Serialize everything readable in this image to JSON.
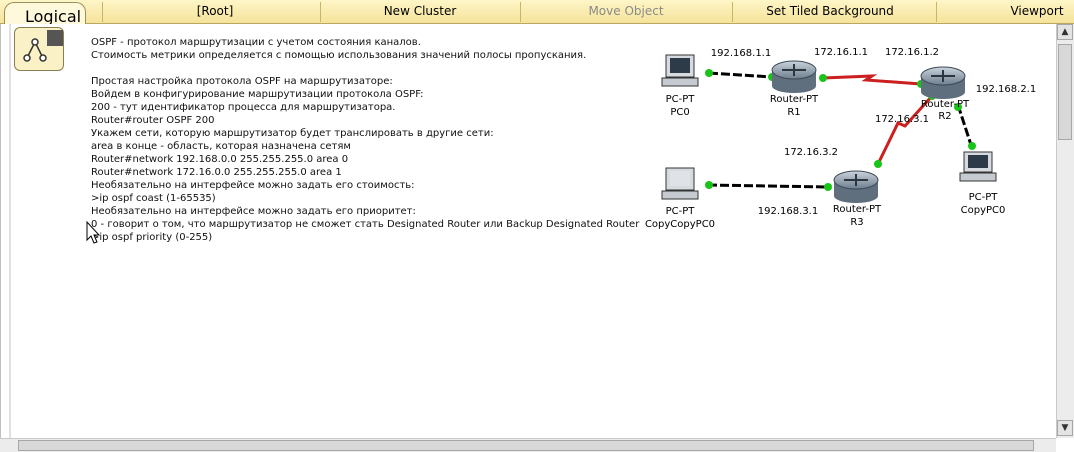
{
  "topbar": {
    "logical_tab": "Logical",
    "buttons": [
      {
        "label": "[Root]",
        "disabled": false
      },
      {
        "label": "New Cluster",
        "disabled": false
      },
      {
        "label": "Move Object",
        "disabled": true
      },
      {
        "label": "Set Tiled Background",
        "disabled": false
      },
      {
        "label": "Viewport",
        "disabled": false
      }
    ]
  },
  "notes": [
    "OSPF - протокол маршрутизации с учетом состояния каналов.",
    "Стоимость метрики определяется с помощью использования значений полосы пропускания.",
    "",
    "Простая настройка протокола OSPF на маршрутизаторе:",
    "Войдем в конфигурирование маршрутизации протокола OSPF:",
    "200 - тут идентификатор процесса для маршрутизатора.",
    "Router#router OSPF 200",
    "Укажем сети, которую маршрутизатор будет транслировать в другие сети:",
    "area в конце - область, которая назначена сетям",
    "Router#network 192.168.0.0 255.255.255.0 area 0",
    "Router#network 172.16.0.0 255.255.255.0 area 1",
    "Необязательно на интерфейсе можно задать его стоимость:",
    ">ip ospf coast (1-65535)",
    "Необязательно на интерфейсе можно задать его приоритет:",
    "0 - говорит о том, что маршрутизатор не сможет стать Designated Router или Backup Designated Router",
    ">ip ospf priority (0-255)"
  ],
  "topology": {
    "devices": {
      "pc0": {
        "type": "PC-PT",
        "name": "PC0"
      },
      "r1": {
        "type": "Router-PT",
        "name": "R1"
      },
      "r2": {
        "type": "Router-PT",
        "name": "R2"
      },
      "copypc0": {
        "type": "PC-PT",
        "name": "CopyPC0"
      },
      "copycopypc0": {
        "type": "PC-PT",
        "name": "CopyCopyPC0"
      },
      "r3": {
        "type": "Router-PT",
        "name": "R3"
      }
    },
    "labels": {
      "net_pc0_r1": "192.168.1.1",
      "r1_r2_a": "172.16.1.1",
      "r1_r2_b": "172.16.1.2",
      "r2_lan": "192.168.2.1",
      "r2_r3_a": "172.16.3.1",
      "r2_r3_b": "172.16.3.2",
      "r3_lan": "192.168.3.1"
    },
    "colors": {
      "ethernet": "#000000",
      "serial": "#cc1f1f",
      "link_up": "#18c418"
    }
  },
  "scroll": {
    "up": "▲",
    "down": "▼"
  }
}
